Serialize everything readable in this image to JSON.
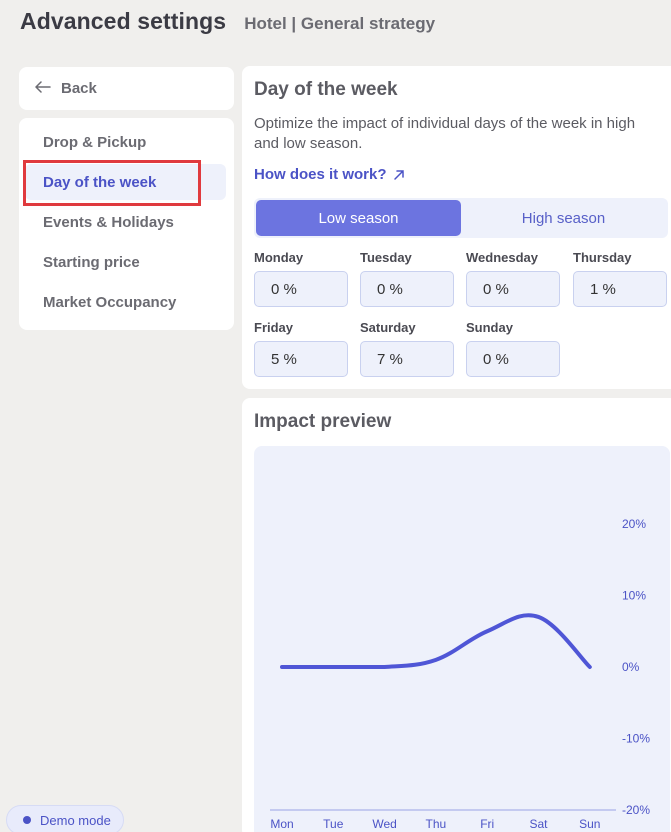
{
  "header": {
    "title": "Advanced settings",
    "subtitle": "Hotel | General strategy"
  },
  "back": {
    "label": "Back"
  },
  "nav": {
    "items": [
      {
        "label": "Drop & Pickup"
      },
      {
        "label": "Day of the week"
      },
      {
        "label": "Events & Holidays"
      },
      {
        "label": "Starting price"
      },
      {
        "label": "Market Occupancy"
      }
    ]
  },
  "dow": {
    "title": "Day of the week",
    "description": "Optimize the impact of individual days of the week in high and low season.",
    "link": "How does it work?",
    "seasons": {
      "low": "Low season",
      "high": "High season",
      "selected": "Low season"
    },
    "days": [
      {
        "label": "Monday",
        "value": "0 %"
      },
      {
        "label": "Tuesday",
        "value": "0 %"
      },
      {
        "label": "Wednesday",
        "value": "0 %"
      },
      {
        "label": "Thursday",
        "value": "1 %"
      },
      {
        "label": "Friday",
        "value": "5 %"
      },
      {
        "label": "Saturday",
        "value": "7 %"
      },
      {
        "label": "Sunday",
        "value": "0 %"
      }
    ]
  },
  "impact": {
    "title": "Impact preview"
  },
  "chart_data": {
    "type": "line",
    "categories": [
      "Mon",
      "Tue",
      "Wed",
      "Thu",
      "Fri",
      "Sat",
      "Sun"
    ],
    "series": [
      {
        "values": [
          0,
          0,
          0,
          1,
          5,
          7,
          0
        ],
        "color": "#4f56d6"
      }
    ],
    "yticks": [
      "20%",
      "10%",
      "0%",
      "-10%",
      "-20%"
    ],
    "ylim": [
      -20,
      20
    ],
    "grid": false
  },
  "demo": {
    "label": "Demo mode"
  },
  "colors": {
    "accent": "#4b53c6",
    "active_toggle": "#6c74e0",
    "highlight": "#e03a3e"
  }
}
